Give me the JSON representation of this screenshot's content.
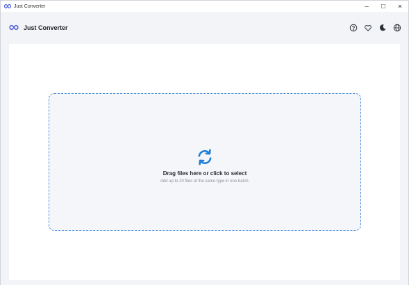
{
  "window": {
    "title": "Just Converter",
    "controls": {
      "minimize": "─",
      "maximize": "☐",
      "close": "✕"
    }
  },
  "header": {
    "app_name": "Just Converter",
    "actions": [
      {
        "icon": "help-circle-icon"
      },
      {
        "icon": "heart-icon"
      },
      {
        "icon": "moon-icon"
      },
      {
        "icon": "globe-icon"
      }
    ]
  },
  "dropzone": {
    "icon": "sync-arrows-icon",
    "title": "Drag files here or click to select",
    "subtitle": "Add up to 20 files of the same type in one batch."
  },
  "colors": {
    "accent": "#1e7fd6",
    "dashed_border": "#4d8fd8",
    "background": "#f3f4f7",
    "panel": "#ffffff"
  }
}
